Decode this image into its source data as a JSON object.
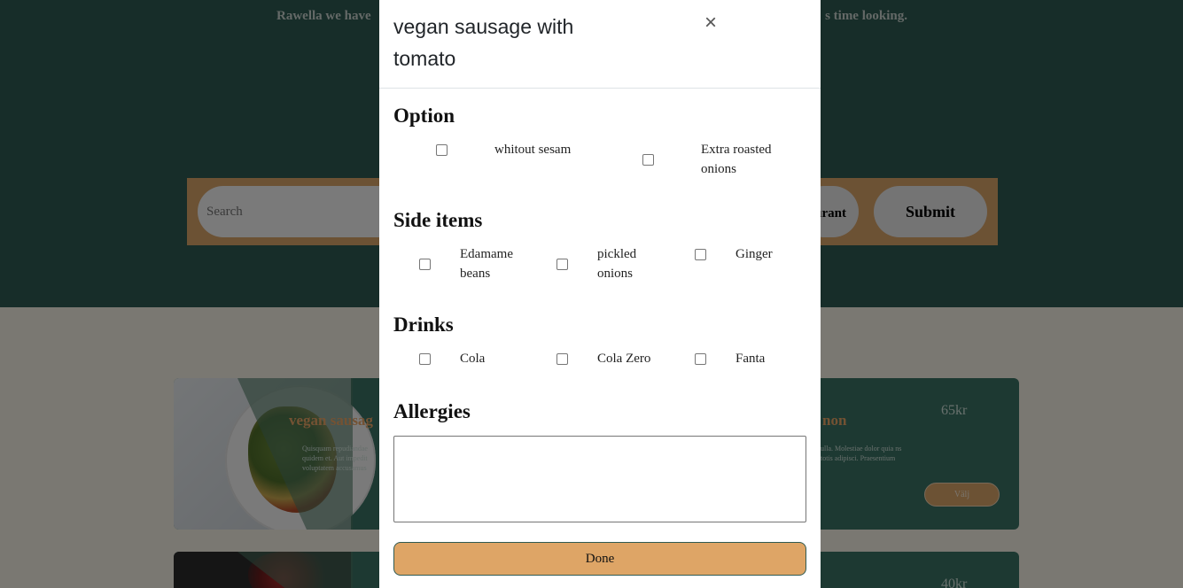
{
  "background": {
    "hero_line1": "",
    "hero_line2_left": "Rawella we have",
    "hero_line2_right": "s time looking.",
    "search_placeholder": "Search",
    "restaurant_button": "urant",
    "submit_button": "Submit",
    "cards": [
      {
        "title": "vegan sausag",
        "title_right": "non",
        "description": "Quisquam repudiandae quidem et. Aut impedit voluptatem accusamus",
        "description_right": "ulla. Molestiae dolor quia ns totis adipisci. Praesentium",
        "price": "65kr",
        "choose_button": "Välj"
      },
      {
        "price": "40kr"
      }
    ]
  },
  "modal": {
    "title": "vegan sausage with tomato",
    "close_symbol": "×",
    "sections": {
      "option": {
        "title": "Option",
        "items": [
          {
            "label_line1": "whitout sesam",
            "label_line2": "",
            "checked": false
          },
          {
            "label_line1": "Extra roasted",
            "label_line2": "onions",
            "checked": false
          }
        ]
      },
      "side_items": {
        "title": "Side items",
        "items": [
          {
            "label_line1": "Edamame",
            "label_line2": "beans",
            "checked": false
          },
          {
            "label_line1": "pickled",
            "label_line2": "onions",
            "checked": false
          },
          {
            "label_line1": "Ginger",
            "label_line2": "",
            "checked": false
          }
        ]
      },
      "drinks": {
        "title": "Drinks",
        "items": [
          {
            "label_line1": "Cola",
            "checked": false
          },
          {
            "label_line1": "Cola Zero",
            "checked": false
          },
          {
            "label_line1": "Fanta",
            "checked": false
          }
        ]
      },
      "allergies": {
        "title": "Allergies",
        "value": ""
      }
    },
    "done_button": "Done"
  }
}
